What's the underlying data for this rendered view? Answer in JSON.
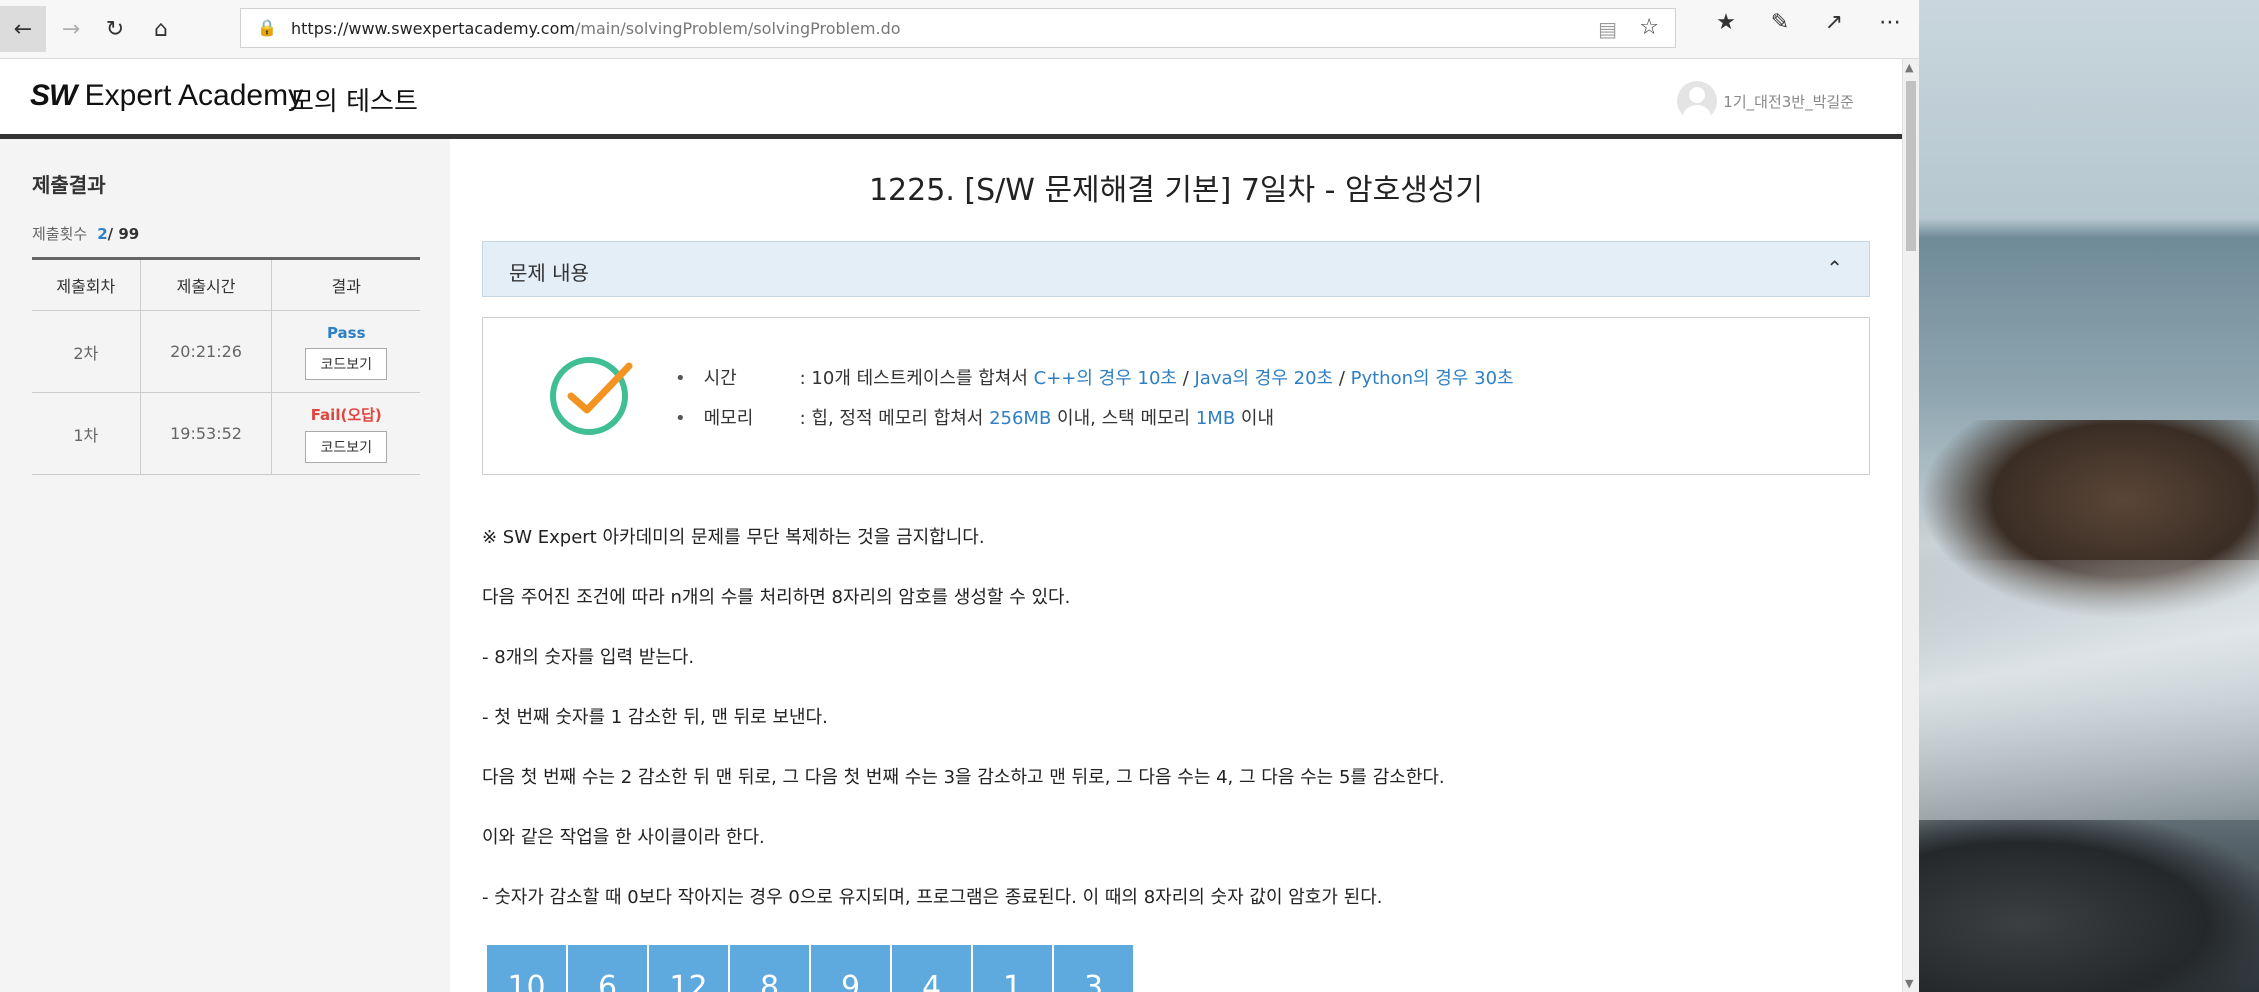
{
  "browser": {
    "url_host": "https://www.swexpertacademy.com",
    "url_path": "/main/solvingProblem/solvingProblem.do"
  },
  "header": {
    "logo_bold": "SW",
    "logo_rest": " Expert Academy",
    "title": "모의 테스트",
    "user_name": "1기_대전3반_박길준"
  },
  "sidebar": {
    "title": "제출결과",
    "count_label": "제출횟수",
    "count_current": "2",
    "count_total": "/ 99",
    "columns": [
      "제출회차",
      "제출시간",
      "결과"
    ],
    "rows": [
      {
        "round": "2차",
        "time": "20:21:26",
        "result": "Pass",
        "button": "코드보기"
      },
      {
        "round": "1차",
        "time": "19:53:52",
        "result": "Fail(오답)",
        "button": "코드보기"
      }
    ]
  },
  "problem": {
    "title": "1225. [S/W 문제해결 기본] 7일차 - 암호생성기",
    "section_label": "문제 내용",
    "time_label": "시간",
    "time_prefix": ": 10개 테스트케이스를 합쳐서 ",
    "time_cpp": "C++의 경우 10초",
    "sep": " / ",
    "time_java": "Java의 경우 20초",
    "time_python": "Python의 경우 30초",
    "mem_label": "메모리",
    "mem_prefix": ": 힙, 정적 메모리 합쳐서 ",
    "mem_heap": "256MB",
    "mem_mid": " 이내, 스택 메모리 ",
    "mem_stack": "1MB",
    "mem_suffix": " 이내",
    "paragraphs": [
      "※ SW Expert 아카데미의 문제를 무단 복제하는 것을 금지합니다.",
      "다음 주어진 조건에 따라 n개의 수를 처리하면 8자리의 암호를 생성할 수 있다.",
      "- 8개의 숫자를 입력 받는다.",
      "- 첫 번째 숫자를 1 감소한 뒤, 맨 뒤로 보낸다.",
      "다음 첫 번째 수는 2 감소한 뒤 맨 뒤로, 그 다음 첫 번째 수는 3을 감소하고 맨 뒤로, 그 다음 수는 4, 그 다음 수는 5를 감소한다.",
      "이와 같은 작업을 한 사이클이라 한다.",
      "- 숫자가 감소할 때 0보다 작아지는 경우 0으로 유지되며, 프로그램은 종료된다. 이 때의 8자리의 숫자 값이 암호가 된다."
    ],
    "numbers": [
      "10",
      "6",
      "12",
      "8",
      "9",
      "4",
      "1",
      "3"
    ]
  }
}
